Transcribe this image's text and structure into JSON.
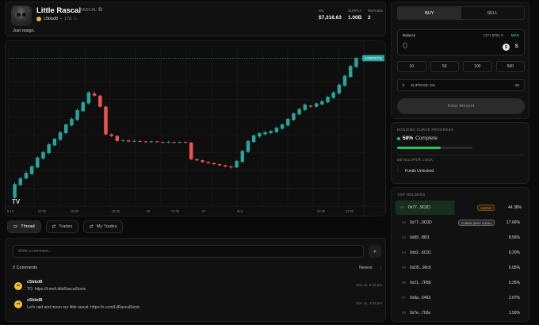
{
  "header": {
    "token_name": "Little Rascal",
    "ticker": "RASCAL",
    "creator": "c5bbd8",
    "age": "17d",
    "description": "Just resign.",
    "stats": [
      {
        "label": "MC",
        "value": "$7,318.63"
      },
      {
        "label": "SUPPLY",
        "value": "1.00B"
      },
      {
        "label": "REPLIES",
        "value": "2"
      }
    ]
  },
  "chart_data": {
    "type": "candlestick",
    "x_tick_labels": [
      "5:12",
      "10:00",
      "15:00",
      "18:00",
      "20",
      "12:00",
      "27",
      "Nov",
      "12:00",
      "13:00"
    ],
    "price_tag": "0.00000731",
    "watermark": "TV",
    "candles": [
      {
        "o": 8.5,
        "c": 11.0,
        "h": 11.3,
        "l": 8.2
      },
      {
        "o": 10.8,
        "c": 12.0,
        "h": 12.3,
        "l": 10.6
      },
      {
        "o": 12.0,
        "c": 13.0,
        "h": 13.4,
        "l": 11.8
      },
      {
        "o": 12.8,
        "c": 14.2,
        "h": 14.5,
        "l": 12.6
      },
      {
        "o": 14.0,
        "c": 15.8,
        "h": 16.0,
        "l": 13.8
      },
      {
        "o": 15.6,
        "c": 16.8,
        "h": 17.0,
        "l": 15.4
      },
      {
        "o": 16.6,
        "c": 18.2,
        "h": 18.5,
        "l": 16.4
      },
      {
        "o": 18.0,
        "c": 19.2,
        "h": 19.4,
        "l": 17.8
      },
      {
        "o": 19.0,
        "c": 20.4,
        "h": 20.6,
        "l": 18.8
      },
      {
        "o": 20.2,
        "c": 21.8,
        "h": 22.0,
        "l": 20.0
      },
      {
        "o": 21.6,
        "c": 22.8,
        "h": 23.1,
        "l": 21.4
      },
      {
        "o": 22.6,
        "c": 24.4,
        "h": 24.7,
        "l": 22.4
      },
      {
        "o": 24.2,
        "c": 25.8,
        "h": 26.1,
        "l": 24.0
      },
      {
        "o": 25.6,
        "c": 27.6,
        "h": 27.8,
        "l": 25.4
      },
      {
        "o": 27.4,
        "c": 27.0,
        "h": 27.8,
        "l": 26.8
      },
      {
        "o": 27.0,
        "c": 25.0,
        "h": 27.2,
        "l": 24.8
      },
      {
        "o": 25.0,
        "c": 20.0,
        "h": 25.2,
        "l": 19.8
      },
      {
        "o": 20.0,
        "c": 19.7,
        "h": 20.2,
        "l": 19.5
      },
      {
        "o": 19.7,
        "c": 18.8,
        "h": 19.9,
        "l": 18.6
      },
      {
        "o": 18.8,
        "c": 18.9,
        "h": 19.1,
        "l": 18.7
      },
      {
        "o": 18.9,
        "c": 18.7,
        "h": 19.0,
        "l": 18.6
      },
      {
        "o": 18.7,
        "c": 18.8,
        "h": 19.0,
        "l": 18.6
      },
      {
        "o": 18.8,
        "c": 18.7,
        "h": 18.9,
        "l": 18.6
      },
      {
        "o": 18.7,
        "c": 18.6,
        "h": 18.8,
        "l": 18.5
      },
      {
        "o": 18.6,
        "c": 18.7,
        "h": 18.9,
        "l": 18.5
      },
      {
        "o": 18.7,
        "c": 18.6,
        "h": 18.8,
        "l": 18.5
      },
      {
        "o": 18.6,
        "c": 18.5,
        "h": 18.7,
        "l": 18.4
      },
      {
        "o": 18.5,
        "c": 18.6,
        "h": 18.8,
        "l": 18.4
      },
      {
        "o": 18.6,
        "c": 18.5,
        "h": 18.7,
        "l": 18.4
      },
      {
        "o": 18.5,
        "c": 18.6,
        "h": 18.7,
        "l": 18.4
      },
      {
        "o": 18.6,
        "c": 18.5,
        "h": 18.7,
        "l": 18.4
      },
      {
        "o": 18.5,
        "c": 15.5,
        "h": 18.6,
        "l": 15.3
      },
      {
        "o": 15.5,
        "c": 15.3,
        "h": 15.6,
        "l": 15.1
      },
      {
        "o": 15.3,
        "c": 15.0,
        "h": 15.4,
        "l": 14.8
      },
      {
        "o": 15.0,
        "c": 14.8,
        "h": 15.1,
        "l": 14.6
      },
      {
        "o": 14.8,
        "c": 14.6,
        "h": 14.9,
        "l": 14.4
      },
      {
        "o": 14.6,
        "c": 14.4,
        "h": 14.7,
        "l": 14.2
      },
      {
        "o": 14.4,
        "c": 14.2,
        "h": 14.5,
        "l": 14.0
      },
      {
        "o": 14.2,
        "c": 14.0,
        "h": 14.3,
        "l": 13.8
      },
      {
        "o": 14.0,
        "c": 15.2,
        "h": 15.4,
        "l": 13.9
      },
      {
        "o": 15.0,
        "c": 17.0,
        "h": 17.2,
        "l": 14.8
      },
      {
        "o": 16.8,
        "c": 18.8,
        "h": 19.0,
        "l": 16.6
      },
      {
        "o": 18.6,
        "c": 19.8,
        "h": 20.0,
        "l": 18.4
      },
      {
        "o": 19.6,
        "c": 20.2,
        "h": 20.4,
        "l": 19.4
      },
      {
        "o": 20.0,
        "c": 20.4,
        "h": 20.6,
        "l": 19.8
      },
      {
        "o": 20.2,
        "c": 20.6,
        "h": 20.8,
        "l": 20.0
      },
      {
        "o": 20.4,
        "c": 21.2,
        "h": 21.4,
        "l": 20.2
      },
      {
        "o": 21.0,
        "c": 21.8,
        "h": 22.0,
        "l": 20.8
      },
      {
        "o": 21.6,
        "c": 22.8,
        "h": 23.0,
        "l": 21.4
      },
      {
        "o": 22.6,
        "c": 23.8,
        "h": 24.0,
        "l": 22.4
      },
      {
        "o": 23.6,
        "c": 24.6,
        "h": 24.8,
        "l": 23.4
      },
      {
        "o": 24.4,
        "c": 25.4,
        "h": 25.6,
        "l": 24.2
      },
      {
        "o": 25.2,
        "c": 25.0,
        "h": 25.4,
        "l": 24.8
      },
      {
        "o": 25.0,
        "c": 25.6,
        "h": 25.8,
        "l": 24.8
      },
      {
        "o": 25.4,
        "c": 26.0,
        "h": 26.2,
        "l": 25.2
      },
      {
        "o": 25.8,
        "c": 26.8,
        "h": 27.0,
        "l": 25.6
      },
      {
        "o": 26.6,
        "c": 27.6,
        "h": 27.8,
        "l": 26.4
      },
      {
        "o": 27.4,
        "c": 29.0,
        "h": 29.2,
        "l": 27.2
      },
      {
        "o": 28.8,
        "c": 30.6,
        "h": 30.8,
        "l": 28.6
      },
      {
        "o": 30.4,
        "c": 32.4,
        "h": 32.6,
        "l": 30.2
      },
      {
        "o": 32.2,
        "c": 33.8,
        "h": 34.0,
        "l": 32.0
      }
    ],
    "ylim": [
      7,
      36
    ],
    "grid": true
  },
  "tabs": [
    {
      "label": "Thread",
      "icon": "chat-icon",
      "active": true
    },
    {
      "label": "Trades",
      "icon": "swap-icon",
      "active": false
    },
    {
      "label": "My Trades",
      "icon": "swap-icon",
      "active": false
    }
  ],
  "thread": {
    "input_placeholder": "Write a comment...",
    "comments_count": "2 Comments",
    "sort": "Newest",
    "comments": [
      {
        "user": "c5bbd8",
        "text": "TG: https://t.me/LittleRascalSonic",
        "time": "Nov 11, 5:32 pm"
      },
      {
        "user": "c5bbd8",
        "text": "Let's raid and moon our little rascal: https://x.com/LilRascalSonic",
        "time": "Nov 11, 4:32 pm"
      }
    ]
  },
  "trade": {
    "buy_label": "BUY",
    "sell_label": "SELL",
    "balance_label": "Balance",
    "balance_value": "1371.8096 S",
    "max_label": "MAX",
    "amount": "0",
    "currency": "S",
    "quick_amounts": [
      "10",
      "50",
      "100",
      "500"
    ],
    "slippage_prefix": "⇅",
    "slippage_label": "SLIPPAGE: 5%",
    "slippage_value": "05",
    "submit_label": "Enter Amount"
  },
  "bonding": {
    "title": "BONDING CURVE PROGRESS",
    "percent": "58%",
    "percent_value": 58,
    "status": "Complete",
    "dev_lock_title": "DEVELOPER LOCK",
    "dev_lock_status": "Funds Unlocked"
  },
  "holders": {
    "title": "TOP HOLDERS",
    "rows": [
      {
        "rank": "#1",
        "address": "0x77...9C0D",
        "badge": "CURVE",
        "badge_color": "#f59e0b",
        "percent": "44.38%"
      },
      {
        "rank": "#2",
        "address": "0x77...9C0D",
        "badge": "CURVE (DEV LOCK)",
        "badge_color": "#cfcfcf",
        "percent": "17.66%"
      },
      {
        "rank": "#3",
        "address": "0x89...f891",
        "badge": "",
        "percent": "8.56%"
      },
      {
        "rank": "#4",
        "address": "0xb2...6C01",
        "badge": "",
        "percent": "8.20%"
      },
      {
        "rank": "#5",
        "address": "0xD5...99c9",
        "badge": "",
        "percent": "6.05%"
      },
      {
        "rank": "#6",
        "address": "0x21...7F89",
        "badge": "",
        "percent": "5.26%"
      },
      {
        "rank": "#7",
        "address": "0x9a...5463",
        "badge": "",
        "percent": "2.07%"
      },
      {
        "rank": "#8",
        "address": "0x7e...702e",
        "badge": "",
        "percent": "1.50%"
      }
    ]
  },
  "colors": {
    "up": "#26a69a",
    "down": "#ef5350",
    "accent": "#22c55e"
  }
}
